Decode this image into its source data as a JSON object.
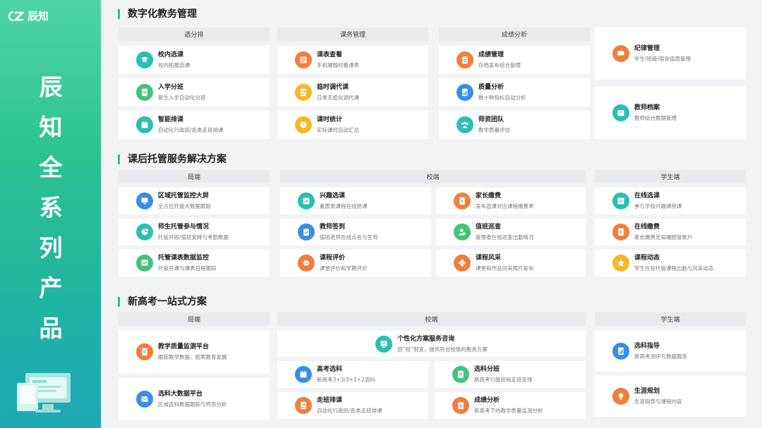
{
  "brand": {
    "logo_text": "辰知",
    "vertical_title": [
      "辰",
      "知",
      "全",
      "系",
      "列",
      "产",
      "品"
    ]
  },
  "sections": [
    {
      "title": "数字化教务管理",
      "headers": [
        "选分排",
        "课务管理",
        "成绩分析"
      ],
      "columns": [
        [
          {
            "title": "校内选课",
            "desc": "校内拓展选课",
            "icon": "graduation-cap-icon",
            "color": "t"
          },
          {
            "title": "入学分班",
            "desc": "新生入学自动化分班",
            "icon": "document-icon",
            "color": "g"
          },
          {
            "title": "智能排课",
            "desc": "自动化行政班/各类走班排课",
            "icon": "calendar-icon",
            "color": "t"
          }
        ],
        [
          {
            "title": "课表查看",
            "desc": "手机端随时看课表",
            "icon": "list-icon",
            "color": "o"
          },
          {
            "title": "临时调代课",
            "desc": "日常无纸化调代课",
            "icon": "swap-document-icon",
            "color": "y"
          },
          {
            "title": "课时统计",
            "desc": "实际课时自动汇总",
            "icon": "clock-icon",
            "color": "y"
          }
        ],
        [
          {
            "title": "成绩管理",
            "desc": "存档发布综合管理",
            "icon": "clipboard-icon",
            "color": "o"
          },
          {
            "title": "质量分析",
            "desc": "数十种指标自动分析",
            "icon": "report-icon",
            "color": "b"
          },
          {
            "title": "师资团队",
            "desc": "教学质量评估",
            "icon": "team-icon",
            "color": "t"
          }
        ],
        [
          {
            "title": "纪律管理",
            "desc": "学生/班级/宿舍值周管理",
            "icon": "chat-icon",
            "color": "o"
          },
          {
            "title": "教师档案",
            "desc": "教师综合数据管理",
            "icon": "archive-icon",
            "color": "t"
          }
        ]
      ]
    },
    {
      "title": "课后托管服务解决方案",
      "headers": [
        "局端",
        "校端",
        "学生端"
      ],
      "columns": [
        [
          {
            "title": "区域托管监控大屏",
            "desc": "全方位托管大数据跟踪",
            "icon": "monitor-icon",
            "color": "b"
          },
          {
            "title": "师生托管参与情况",
            "desc": "托管开班/值班安排与考勤数据",
            "icon": "pie-chart-icon",
            "color": "t"
          },
          {
            "title": "托管课表数据监控",
            "desc": "托管开课与课表日程跟踪",
            "icon": "line-chart-icon",
            "color": "g"
          }
        ],
        [
          {
            "title": "兴趣选课",
            "desc": "素质类课程在线抢课",
            "icon": "select-icon",
            "color": "t"
          },
          {
            "title": "教师签到",
            "desc": "值班老师在线点名与签到",
            "icon": "checkin-icon",
            "color": "b"
          },
          {
            "title": "课程评价",
            "desc": "课堂评价和学期评价",
            "icon": "comment-icon",
            "color": "o"
          }
        ],
        [
          {
            "title": "家长缴费",
            "desc": "发布选课对应课程缴费单",
            "icon": "bill-icon",
            "color": "o"
          },
          {
            "title": "值班巡查",
            "desc": "管理者在线巡查出勤情况",
            "icon": "user-check-icon",
            "color": "g"
          },
          {
            "title": "课程风采",
            "desc": "课堂和作品风采照片发布",
            "icon": "flower-icon",
            "color": "o"
          }
        ],
        [
          {
            "title": "在线选课",
            "desc": "参与学校兴趣课抢课",
            "icon": "select-icon",
            "color": "t"
          },
          {
            "title": "在线缴费",
            "desc": "家长缴费至局端统管账户",
            "icon": "bill-icon",
            "color": "o"
          },
          {
            "title": "课程动态",
            "desc": "学生在校托管课程出勤与风采动态",
            "icon": "star-icon",
            "color": "y"
          }
        ]
      ]
    },
    {
      "title": "新高考一站式方案",
      "headers": [
        "局端",
        "校端",
        "学生端"
      ],
      "left": [
        {
          "title": "教学质量监测平台",
          "desc": "跟踪教学数据，统筹教育发展",
          "icon": "document-icon",
          "color": "o"
        },
        {
          "title": "选科大数据平台",
          "desc": "区域选科数据跟踪与师资分析",
          "icon": "mail-icon",
          "color": "b"
        }
      ],
      "top": {
        "title": "个性化方案服务咨询",
        "desc": "因“校”制宜，提供符合校情的教务方案",
        "icon": "consult-icon",
        "color": "t"
      },
      "mid_left": [
        {
          "title": "高考选科",
          "desc": "新高考3+3/3+1+2选科",
          "icon": "calendar-icon",
          "color": "b"
        },
        {
          "title": "走班排课",
          "desc": "自动化行政班/各类走班排课",
          "icon": "swap-document-icon",
          "color": "o"
        }
      ],
      "mid_right": [
        {
          "title": "选科分班",
          "desc": "新高考行政班和走班安排",
          "icon": "document-icon",
          "color": "g"
        },
        {
          "title": "成绩分析",
          "desc": "新高考下的教学质量监测分析",
          "icon": "clipboard-icon",
          "color": "o"
        }
      ],
      "right": [
        {
          "title": "选科指导",
          "desc": "新高考测评与数据服务",
          "icon": "report-icon",
          "color": "b"
        },
        {
          "title": "生涯规划",
          "desc": "生涯指导与课程内容",
          "icon": "bulb-icon",
          "color": "o"
        }
      ]
    }
  ]
}
